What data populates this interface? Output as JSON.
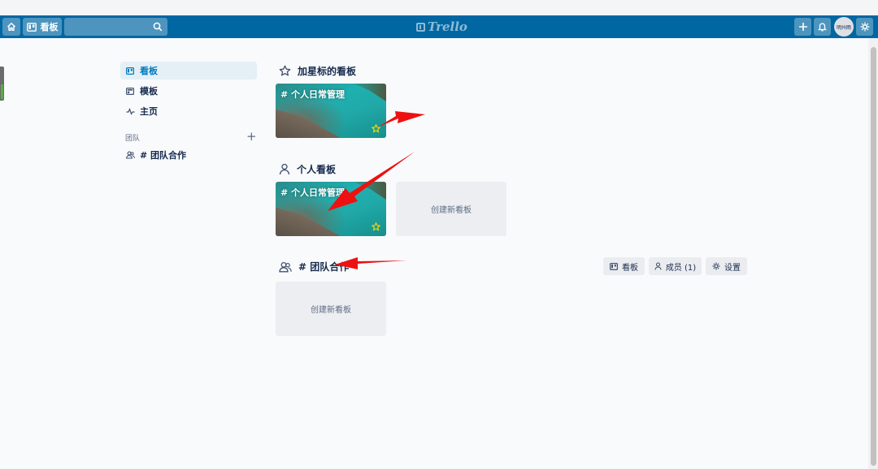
{
  "header": {
    "boards_label": "看板",
    "avatar_text": "明州雨",
    "logo_text": "Trello"
  },
  "sidebar": {
    "items": [
      {
        "label": "看板",
        "icon": "board-icon",
        "active": true
      },
      {
        "label": "模板",
        "icon": "template-icon",
        "active": false
      },
      {
        "label": "主页",
        "icon": "activity-icon",
        "active": false
      }
    ],
    "team_section_label": "团队",
    "team_add_symbol": "+",
    "teams": [
      {
        "label": "# 团队合作",
        "icon": "team-icon"
      }
    ]
  },
  "starred": {
    "title": "加星标的看板",
    "boards": [
      {
        "name": "# 个人日常管理",
        "starred": true
      }
    ]
  },
  "personal": {
    "title": "个人看板",
    "boards": [
      {
        "name": "# 个人日常管理",
        "starred": true
      }
    ],
    "create_label": "创建新看板"
  },
  "team": {
    "title": "# 团队合作",
    "buttons": {
      "boards": "看板",
      "members": "成员 (1)",
      "settings": "设置"
    },
    "create_label": "创建新看板"
  },
  "colors": {
    "header": "#0067a3",
    "accent": "#0079bf",
    "star": "#f2d600",
    "annotation": "#ee1111"
  }
}
